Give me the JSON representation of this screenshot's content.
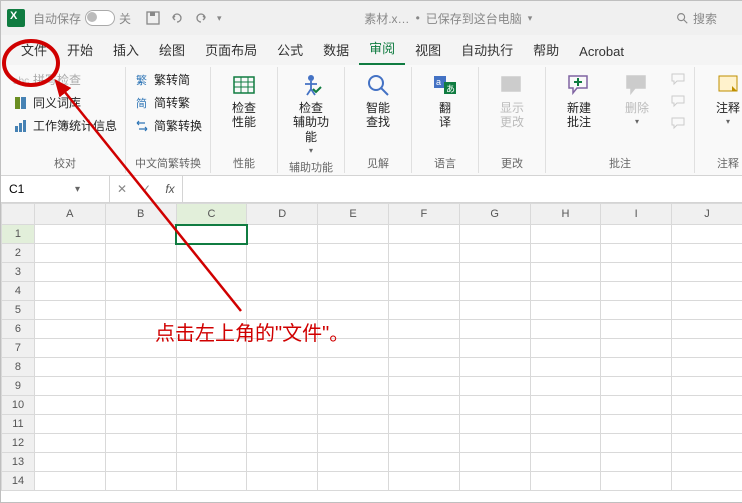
{
  "colors": {
    "accent": "#107c41",
    "annotation": "#d00000"
  },
  "titlebar": {
    "autosave_label": "自动保存",
    "autosave_off": "关",
    "filename": "素材.x…",
    "saved_status": "已保存到这台电脑",
    "search_placeholder": "搜索"
  },
  "tabs": {
    "file": "文件",
    "home": "开始",
    "insert": "插入",
    "draw": "绘图",
    "layout": "页面布局",
    "formulas": "公式",
    "data": "数据",
    "review": "审阅",
    "view": "视图",
    "automate": "自动执行",
    "help": "帮助",
    "acrobat": "Acrobat"
  },
  "ribbon": {
    "proofing": {
      "spell": "拼写检查",
      "thesaurus": "同义词库",
      "stats": "工作簿统计信息",
      "label": "校对"
    },
    "chinese": {
      "trad": "繁转简",
      "simp": "简转繁",
      "conv": "简繁转换",
      "label": "中文简繁转换"
    },
    "perf": {
      "btn": "检查\n性能",
      "label": "性能"
    },
    "acc": {
      "btn": "检查\n辅助功能",
      "label": "辅助功能"
    },
    "insights": {
      "btn": "智能\n查找",
      "label": "见解"
    },
    "lang": {
      "btn": "翻\n译",
      "label": "语言"
    },
    "changes": {
      "btn": "显示\n更改",
      "label": "更改"
    },
    "comments": {
      "new": "新建\n批注",
      "del": "删除",
      "prev": "",
      "next": "",
      "show": "",
      "label": "批注"
    },
    "notes": {
      "btn": "注释",
      "label": "注释"
    }
  },
  "formula_bar": {
    "name_box": "C1",
    "fx": "fx",
    "formula": ""
  },
  "grid": {
    "columns": [
      "A",
      "B",
      "C",
      "D",
      "E",
      "F",
      "G",
      "H",
      "I",
      "J"
    ],
    "rows": [
      "1",
      "2",
      "3",
      "4",
      "5",
      "6",
      "7",
      "8",
      "9",
      "10",
      "11",
      "12",
      "13",
      "14"
    ],
    "active_cell": "C1"
  },
  "annotation": {
    "text": "点击左上角的\"文件\"。"
  }
}
